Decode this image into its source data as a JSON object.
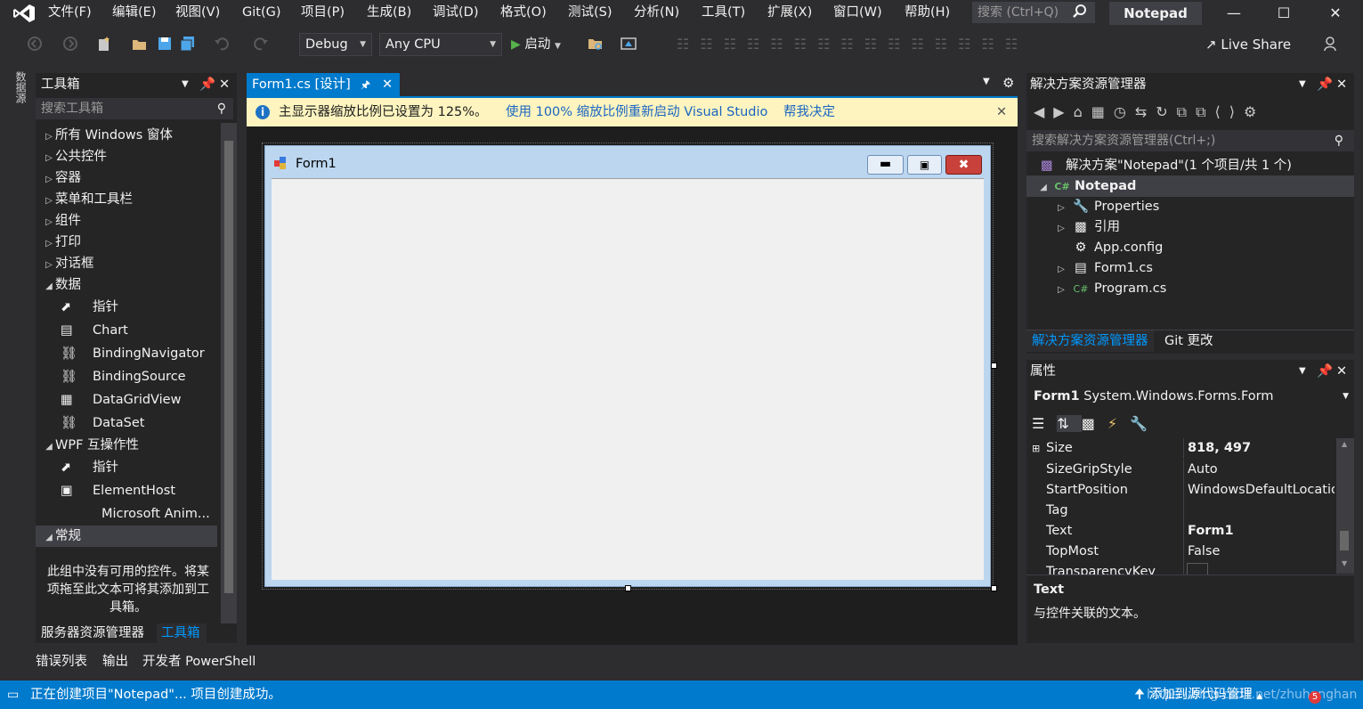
{
  "menubar": {
    "items": [
      "文件(F)",
      "编辑(E)",
      "视图(V)",
      "Git(G)",
      "项目(P)",
      "生成(B)",
      "调试(D)",
      "格式(O)",
      "测试(S)",
      "分析(N)",
      "工具(T)",
      "扩展(X)",
      "窗口(W)",
      "帮助(H)"
    ],
    "search_placeholder": "搜索 (Ctrl+Q)",
    "title": "Notepad"
  },
  "toolbar": {
    "config": "Debug",
    "platform": "Any CPU",
    "start_label": "启动",
    "liveshare_label": "Live Share"
  },
  "left_strip": {
    "label": "数据源"
  },
  "toolbox": {
    "title": "工具箱",
    "search_placeholder": "搜索工具箱",
    "categories": [
      "所有 Windows 窗体",
      "公共控件",
      "容器",
      "菜单和工具栏",
      "组件",
      "打印",
      "对话框",
      "数据"
    ],
    "data_items": [
      "指针",
      "Chart",
      "BindingNavigator",
      "BindingSource",
      "DataGridView",
      "DataSet"
    ],
    "wpf_category": "WPF 互操作性",
    "wpf_items": [
      "指针",
      "ElementHost",
      "Microsoft Anim..."
    ],
    "general_category": "常规",
    "empty_message": "此组中没有可用的控件。将某项拖至此文本可将其添加到工具箱。",
    "tabs": [
      "服务器资源管理器",
      "工具箱"
    ]
  },
  "bottom_tabs": [
    "错误列表",
    "输出",
    "开发者 PowerShell"
  ],
  "designer": {
    "tab_label": "Form1.cs [设计]",
    "info_message": "主显示器缩放比例已设置为 125%。",
    "info_link1": "使用 100% 缩放比例重新启动 Visual Studio",
    "info_link2": "帮我决定",
    "form_title": "Form1"
  },
  "solution_explorer": {
    "title": "解决方案资源管理器",
    "search_placeholder": "搜索解决方案资源管理器(Ctrl+;)",
    "solution_label": "解决方案\"Notepad\"(1 个项目/共 1 个)",
    "project_label": "Notepad",
    "items": [
      "Properties",
      "引用",
      "App.config",
      "Form1.cs",
      "Program.cs"
    ],
    "tabs": [
      "解决方案资源管理器",
      "Git 更改"
    ]
  },
  "properties": {
    "title": "属性",
    "object_name": "Form1",
    "object_type": "System.Windows.Forms.Form",
    "rows": [
      {
        "name": "Size",
        "value": "818, 497"
      },
      {
        "name": "SizeGripStyle",
        "value": "Auto"
      },
      {
        "name": "StartPosition",
        "value": "WindowsDefaultLocation"
      },
      {
        "name": "Tag",
        "value": ""
      },
      {
        "name": "Text",
        "value": "Form1"
      },
      {
        "name": "TopMost",
        "value": "False"
      },
      {
        "name": "TransparencyKey",
        "value": ""
      }
    ],
    "desc_title": "Text",
    "desc_text": "与控件关联的文本。"
  },
  "statusbar": {
    "message": "正在创建项目\"Notepad\"... 项目创建成功。",
    "source_control": "添加到源代码管理",
    "watermark": "https://blog.csdn.net/zhuhanghan",
    "badge": "5"
  }
}
